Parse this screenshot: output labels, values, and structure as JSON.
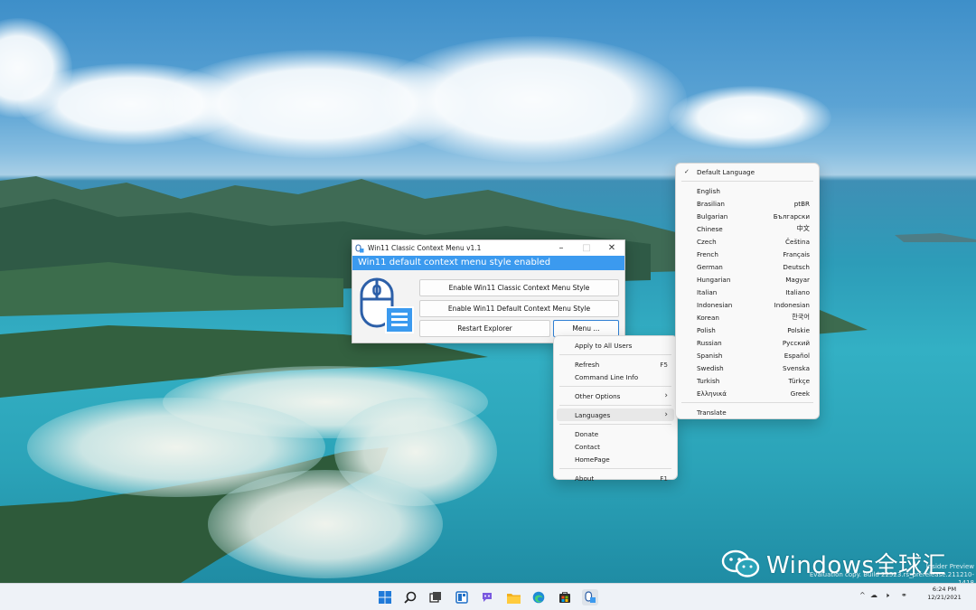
{
  "app_window": {
    "title": "Win11 Classic Context Menu v1.1",
    "status": "Win11 default context menu style enabled",
    "buttons": {
      "enable_classic": "Enable Win11 Classic Context Menu Style",
      "enable_default": "Enable Win11 Default Context Menu Style",
      "restart_explorer": "Restart Explorer",
      "menu": "Menu ..."
    },
    "accent_color": "#3b9aef"
  },
  "main_menu": {
    "apply_all": "Apply to All Users",
    "refresh": "Refresh",
    "refresh_shortcut": "F5",
    "cmdline": "Command Line Info",
    "other_options": "Other Options",
    "languages": "Languages",
    "donate": "Donate",
    "contact": "Contact",
    "homepage": "HomePage",
    "about": "About",
    "about_shortcut": "F1"
  },
  "languages_menu": {
    "default_language": "Default Language",
    "translate": "Translate",
    "items": [
      {
        "name": "English",
        "native": ""
      },
      {
        "name": "Brasilian",
        "native": "ptBR"
      },
      {
        "name": "Bulgarian",
        "native": "Български"
      },
      {
        "name": "Chinese",
        "native": "中文"
      },
      {
        "name": "Czech",
        "native": "Čeština"
      },
      {
        "name": "French",
        "native": "Français"
      },
      {
        "name": "German",
        "native": "Deutsch"
      },
      {
        "name": "Hungarian",
        "native": "Magyar"
      },
      {
        "name": "Italian",
        "native": "Italiano"
      },
      {
        "name": "Indonesian",
        "native": "Indonesian"
      },
      {
        "name": "Korean",
        "native": "한국어"
      },
      {
        "name": "Polish",
        "native": "Polskie"
      },
      {
        "name": "Russian",
        "native": "Русский"
      },
      {
        "name": "Spanish",
        "native": "Español"
      },
      {
        "name": "Swedish",
        "native": "Svenska"
      },
      {
        "name": "Turkish",
        "native": "Türkçe"
      },
      {
        "name": "Ελληνικά",
        "native": "Greek"
      }
    ]
  },
  "watermark": {
    "text": "Windows全球汇",
    "insider_line1": "Insider Preview",
    "insider_line2": "Evaluation copy. Build 22523.rs_prerelease.211210-1418"
  },
  "taskbar": {
    "time": "6:24 PM",
    "date": "12/21/2021",
    "icons": [
      "windows-start-icon",
      "search-icon",
      "task-view-icon",
      "widgets-icon",
      "chat-icon",
      "file-explorer-icon",
      "edge-icon",
      "store-icon",
      "context-menu-app-icon"
    ]
  }
}
